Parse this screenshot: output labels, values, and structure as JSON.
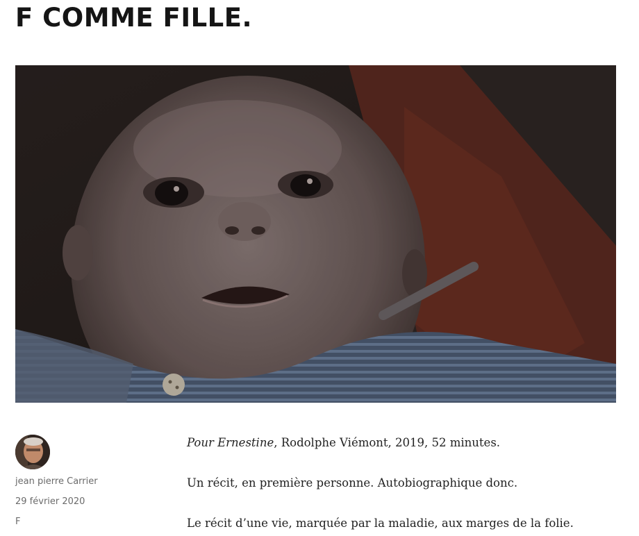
{
  "post": {
    "title": "F COMME FILLE.",
    "image_alt": "Bébé allongé regardant l'objectif"
  },
  "meta": {
    "author": "jean pierre Carrier",
    "date": "29 février 2020",
    "category": "F"
  },
  "content": {
    "p1_italic": "Pour Ernestine",
    "p1_rest": ", Rodolphe Viémont, 2019, 52 minutes.",
    "p2": "Un récit, en première personne. Autobiographique donc.",
    "p3": "Le récit d’une vie, marquée par la maladie, aux marges de la folie."
  }
}
